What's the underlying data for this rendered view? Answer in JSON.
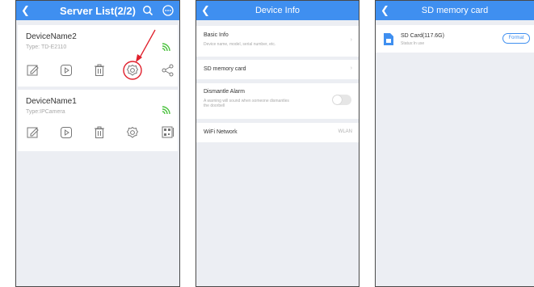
{
  "screen1": {
    "title": "Server List(2/2)",
    "devices": [
      {
        "name": "DeviceName2",
        "type": "Type: TD-E2110"
      },
      {
        "name": "DeviceName1",
        "type": "Type:IPCamera"
      }
    ],
    "icons": [
      "back-icon",
      "search-icon",
      "more-icon",
      "wifi-signal-icon",
      "edit-icon",
      "playback-icon",
      "delete-icon",
      "settings-icon",
      "share-icon",
      "qr-code-icon"
    ],
    "colors": {
      "header": "#3f8ff0",
      "highlight": "#e0202c",
      "signal": "#4cc23f"
    }
  },
  "screen2": {
    "title": "Device Info",
    "basic_info": {
      "title": "Basic Info",
      "subtitle": "Device name, model, serial number, etc."
    },
    "sd_card": {
      "title": "SD memory card"
    },
    "dismantle": {
      "title": "Dismantle Alarm",
      "subtitle_line1": "A warning will sound when someone dismantles",
      "subtitle_line2": "the doorbell",
      "toggle_on": false
    },
    "wifi": {
      "title": "WiFi Network",
      "value": "WLAN"
    }
  },
  "screen3": {
    "title": "SD memory card",
    "card": {
      "name": "SD Card(117.6G)",
      "status": "Status:In use",
      "button": "Format"
    }
  }
}
